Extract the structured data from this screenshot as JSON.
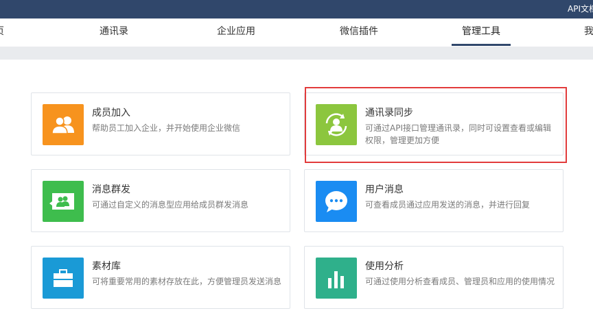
{
  "topbar": {
    "api_doc": "API文档"
  },
  "nav": {
    "partial_left": "页",
    "items": [
      "通讯录",
      "企业应用",
      "微信插件",
      "管理工具"
    ],
    "partial_right": "我"
  },
  "colors": {
    "topbar": "#30476b",
    "orange": "#f7931e",
    "lime": "#8cc63e",
    "green": "#3ebd4d",
    "blue": "#1a8cf2",
    "teal": "#1a9ad6",
    "seagreen": "#2fb08b",
    "highlight": "#e23b3b"
  },
  "cards": [
    {
      "title": "成员加入",
      "desc": "帮助员工加入企业，并开始使用企业微信",
      "icon": "members-icon"
    },
    {
      "title": "通讯录同步",
      "desc": "可通过API接口管理通讯录，同时可设置查看或编辑权限，管理更加方便",
      "icon": "sync-icon"
    },
    {
      "title": "消息群发",
      "desc": "可通过自定义的消息型应用给成员群发消息",
      "icon": "broadcast-icon"
    },
    {
      "title": "用户消息",
      "desc": "可查看成员通过应用发送的消息，并进行回复",
      "icon": "chat-icon"
    },
    {
      "title": "素材库",
      "desc": "可将重要常用的素材存放在此，方便管理员发送消息",
      "icon": "briefcase-icon"
    },
    {
      "title": "使用分析",
      "desc": "可通过使用分析查看成员、管理员和应用的使用情况",
      "icon": "bar-chart-icon"
    }
  ]
}
